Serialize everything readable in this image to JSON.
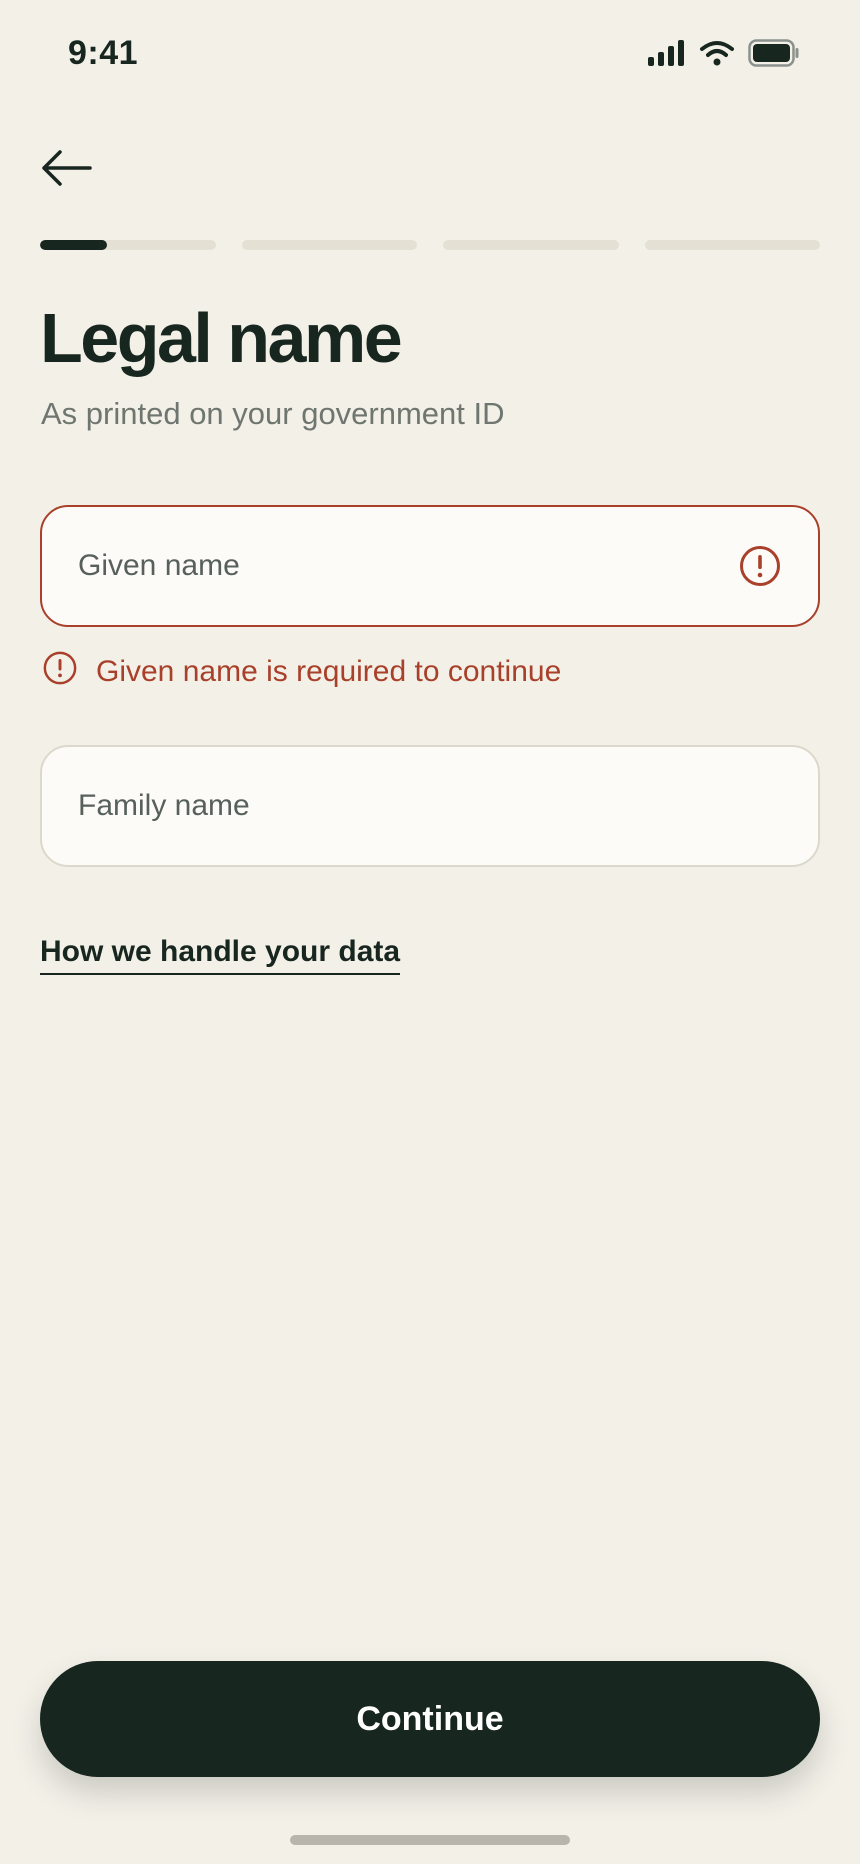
{
  "status_bar": {
    "time": "9:41",
    "icons": [
      "signal-icon",
      "wifi-icon",
      "battery-icon"
    ]
  },
  "navigation": {
    "back_icon": "arrow-left-icon"
  },
  "progress": {
    "total_steps": 4,
    "current_step": 1,
    "current_step_fill": 0.38
  },
  "header": {
    "title": "Legal name",
    "subtitle": "As printed on your government ID"
  },
  "form": {
    "given_name": {
      "placeholder": "Given name",
      "value": "",
      "state": "error",
      "error_icon": "alert-circle-icon",
      "error_message": "Given name is required to continue"
    },
    "family_name": {
      "placeholder": "Family name",
      "value": ""
    }
  },
  "links": {
    "data_handling": "How we handle your data"
  },
  "actions": {
    "continue_label": "Continue"
  },
  "colors": {
    "background": "#f3f0e8",
    "primary": "#17261f",
    "error": "#a8402a",
    "muted_text": "#6f7670",
    "field_background": "#fdfbf8",
    "progress_track": "#e4e0d4"
  }
}
